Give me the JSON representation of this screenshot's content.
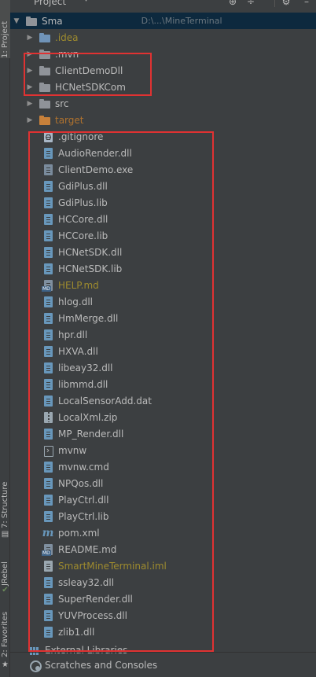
{
  "sidebar_tabs": {
    "project": "1: Project",
    "structure": "7: Structure",
    "jrebel": "JRebel",
    "favorites": "2: Favorites"
  },
  "header": {
    "title": "Project",
    "actions": [
      "globe-icon",
      "gear-icon"
    ]
  },
  "tree": {
    "root": {
      "label": "Sma",
      "path_hint": "D:\\...\\MineTerminal"
    },
    "folders": [
      {
        "label": ".idea",
        "color": "blue"
      },
      {
        "label": ".mvn",
        "color": "gray"
      },
      {
        "label": "ClientDemoDll",
        "color": "gray"
      },
      {
        "label": "HCNetSDKCom",
        "color": "gray"
      },
      {
        "label": "src",
        "color": "gray"
      },
      {
        "label": "target",
        "color": "orange"
      }
    ],
    "files": [
      {
        "label": ".gitignore",
        "type": "gitignore"
      },
      {
        "label": "AudioRender.dll",
        "type": "dll"
      },
      {
        "label": "ClientDemo.exe",
        "type": "exe"
      },
      {
        "label": "GdiPlus.dll",
        "type": "dll"
      },
      {
        "label": "GdiPlus.lib",
        "type": "dll"
      },
      {
        "label": "HCCore.dll",
        "type": "dll"
      },
      {
        "label": "HCCore.lib",
        "type": "dll"
      },
      {
        "label": "HCNetSDK.dll",
        "type": "dll"
      },
      {
        "label": "HCNetSDK.lib",
        "type": "dll"
      },
      {
        "label": "HELP.md",
        "type": "md",
        "color": "olive"
      },
      {
        "label": "hlog.dll",
        "type": "dll"
      },
      {
        "label": "HmMerge.dll",
        "type": "dll"
      },
      {
        "label": "hpr.dll",
        "type": "dll"
      },
      {
        "label": "HXVA.dll",
        "type": "dll"
      },
      {
        "label": "libeay32.dll",
        "type": "dll"
      },
      {
        "label": "libmmd.dll",
        "type": "dll"
      },
      {
        "label": "LocalSensorAdd.dat",
        "type": "dll"
      },
      {
        "label": "LocalXml.zip",
        "type": "zip"
      },
      {
        "label": "MP_Render.dll",
        "type": "dll"
      },
      {
        "label": "mvnw",
        "type": "mvnw"
      },
      {
        "label": "mvnw.cmd",
        "type": "dll"
      },
      {
        "label": "NPQos.dll",
        "type": "dll"
      },
      {
        "label": "PlayCtrl.dll",
        "type": "dll"
      },
      {
        "label": "PlayCtrl.lib",
        "type": "dll"
      },
      {
        "label": "pom.xml",
        "type": "maven"
      },
      {
        "label": "README.md",
        "type": "md"
      },
      {
        "label": "SmartMineTerminal.iml",
        "type": "iml",
        "color": "olive"
      },
      {
        "label": "ssleay32.dll",
        "type": "dll"
      },
      {
        "label": "SuperRender.dll",
        "type": "dll"
      },
      {
        "label": "YUVProcess.dll",
        "type": "dll"
      },
      {
        "label": "zlib1.dll",
        "type": "dll"
      }
    ],
    "external_libraries": "External Libraries",
    "scratches": "Scratches and Consoles"
  },
  "colors": {
    "accent_selection": "#0d293e",
    "annotation_red": "#e03232",
    "folder_orange": "#c7803a",
    "text_olive": "#9e8b2e"
  }
}
